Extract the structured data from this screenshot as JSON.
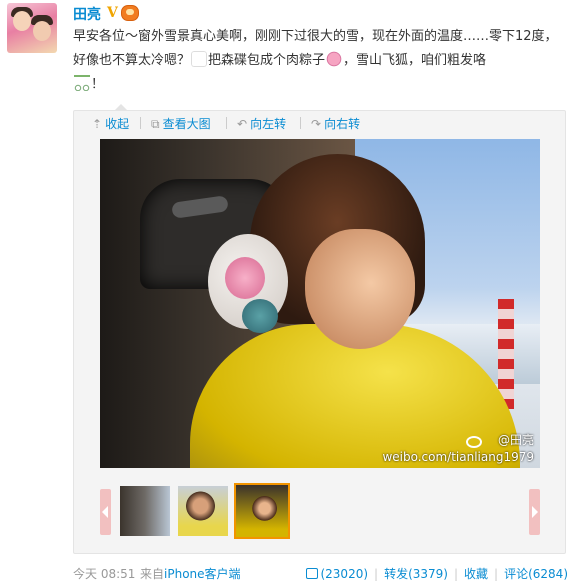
{
  "user": {
    "name": "田亮",
    "verified_mark": "V"
  },
  "post": {
    "text_1": "早安各位～窗外雪景真心美啊，刚刚下过很大的雪，现在外面的温度……零下12度，好像也不算太冷嗯？",
    "text_2": "把森碟包成个肉粽子",
    "text_3": "，雪山飞狐，咱们粗发咯",
    "text_4": "！"
  },
  "toolbar": {
    "collapse": "收起",
    "view_large": "查看大图",
    "rotate_left": "向左转",
    "rotate_right": "向右转"
  },
  "photo": {
    "watermark_name": "@田亮",
    "watermark_url": "weibo.com/tianliang1979"
  },
  "footer": {
    "time": "今天 08:51",
    "source_prefix": "来自",
    "source_link": "iPhone客户端",
    "likes": "(23020)",
    "repost": "转发(3379)",
    "favorite": "收藏",
    "comment": "评论(6284)"
  },
  "colors": {
    "link": "#0a8cd2",
    "accent": "#f29400",
    "meta": "#999999"
  }
}
